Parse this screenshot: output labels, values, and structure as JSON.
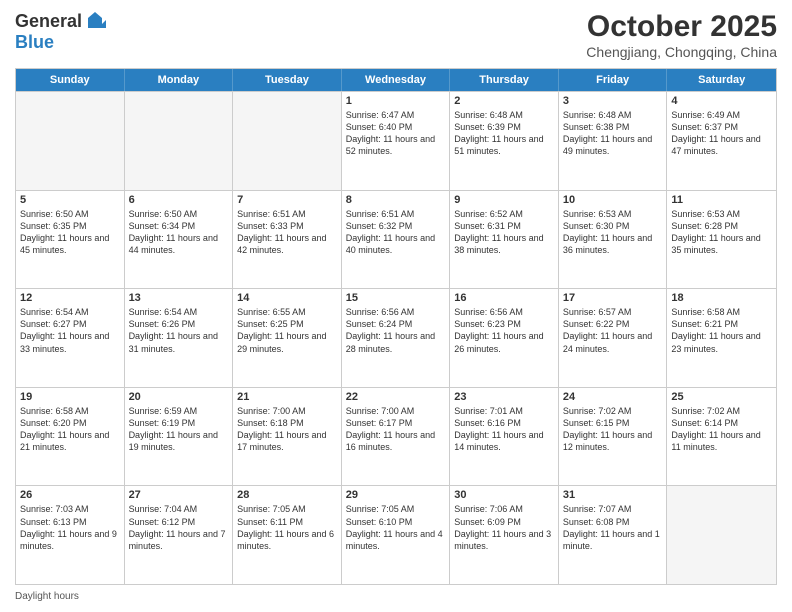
{
  "logo": {
    "general": "General",
    "blue": "Blue"
  },
  "header": {
    "month": "October 2025",
    "location": "Chengjiang, Chongqing, China"
  },
  "weekdays": [
    "Sunday",
    "Monday",
    "Tuesday",
    "Wednesday",
    "Thursday",
    "Friday",
    "Saturday"
  ],
  "weeks": [
    [
      {
        "day": "",
        "detail": ""
      },
      {
        "day": "",
        "detail": ""
      },
      {
        "day": "",
        "detail": ""
      },
      {
        "day": "1",
        "detail": "Sunrise: 6:47 AM\nSunset: 6:40 PM\nDaylight: 11 hours and 52 minutes."
      },
      {
        "day": "2",
        "detail": "Sunrise: 6:48 AM\nSunset: 6:39 PM\nDaylight: 11 hours and 51 minutes."
      },
      {
        "day": "3",
        "detail": "Sunrise: 6:48 AM\nSunset: 6:38 PM\nDaylight: 11 hours and 49 minutes."
      },
      {
        "day": "4",
        "detail": "Sunrise: 6:49 AM\nSunset: 6:37 PM\nDaylight: 11 hours and 47 minutes."
      }
    ],
    [
      {
        "day": "5",
        "detail": "Sunrise: 6:50 AM\nSunset: 6:35 PM\nDaylight: 11 hours and 45 minutes."
      },
      {
        "day": "6",
        "detail": "Sunrise: 6:50 AM\nSunset: 6:34 PM\nDaylight: 11 hours and 44 minutes."
      },
      {
        "day": "7",
        "detail": "Sunrise: 6:51 AM\nSunset: 6:33 PM\nDaylight: 11 hours and 42 minutes."
      },
      {
        "day": "8",
        "detail": "Sunrise: 6:51 AM\nSunset: 6:32 PM\nDaylight: 11 hours and 40 minutes."
      },
      {
        "day": "9",
        "detail": "Sunrise: 6:52 AM\nSunset: 6:31 PM\nDaylight: 11 hours and 38 minutes."
      },
      {
        "day": "10",
        "detail": "Sunrise: 6:53 AM\nSunset: 6:30 PM\nDaylight: 11 hours and 36 minutes."
      },
      {
        "day": "11",
        "detail": "Sunrise: 6:53 AM\nSunset: 6:28 PM\nDaylight: 11 hours and 35 minutes."
      }
    ],
    [
      {
        "day": "12",
        "detail": "Sunrise: 6:54 AM\nSunset: 6:27 PM\nDaylight: 11 hours and 33 minutes."
      },
      {
        "day": "13",
        "detail": "Sunrise: 6:54 AM\nSunset: 6:26 PM\nDaylight: 11 hours and 31 minutes."
      },
      {
        "day": "14",
        "detail": "Sunrise: 6:55 AM\nSunset: 6:25 PM\nDaylight: 11 hours and 29 minutes."
      },
      {
        "day": "15",
        "detail": "Sunrise: 6:56 AM\nSunset: 6:24 PM\nDaylight: 11 hours and 28 minutes."
      },
      {
        "day": "16",
        "detail": "Sunrise: 6:56 AM\nSunset: 6:23 PM\nDaylight: 11 hours and 26 minutes."
      },
      {
        "day": "17",
        "detail": "Sunrise: 6:57 AM\nSunset: 6:22 PM\nDaylight: 11 hours and 24 minutes."
      },
      {
        "day": "18",
        "detail": "Sunrise: 6:58 AM\nSunset: 6:21 PM\nDaylight: 11 hours and 23 minutes."
      }
    ],
    [
      {
        "day": "19",
        "detail": "Sunrise: 6:58 AM\nSunset: 6:20 PM\nDaylight: 11 hours and 21 minutes."
      },
      {
        "day": "20",
        "detail": "Sunrise: 6:59 AM\nSunset: 6:19 PM\nDaylight: 11 hours and 19 minutes."
      },
      {
        "day": "21",
        "detail": "Sunrise: 7:00 AM\nSunset: 6:18 PM\nDaylight: 11 hours and 17 minutes."
      },
      {
        "day": "22",
        "detail": "Sunrise: 7:00 AM\nSunset: 6:17 PM\nDaylight: 11 hours and 16 minutes."
      },
      {
        "day": "23",
        "detail": "Sunrise: 7:01 AM\nSunset: 6:16 PM\nDaylight: 11 hours and 14 minutes."
      },
      {
        "day": "24",
        "detail": "Sunrise: 7:02 AM\nSunset: 6:15 PM\nDaylight: 11 hours and 12 minutes."
      },
      {
        "day": "25",
        "detail": "Sunrise: 7:02 AM\nSunset: 6:14 PM\nDaylight: 11 hours and 11 minutes."
      }
    ],
    [
      {
        "day": "26",
        "detail": "Sunrise: 7:03 AM\nSunset: 6:13 PM\nDaylight: 11 hours and 9 minutes."
      },
      {
        "day": "27",
        "detail": "Sunrise: 7:04 AM\nSunset: 6:12 PM\nDaylight: 11 hours and 7 minutes."
      },
      {
        "day": "28",
        "detail": "Sunrise: 7:05 AM\nSunset: 6:11 PM\nDaylight: 11 hours and 6 minutes."
      },
      {
        "day": "29",
        "detail": "Sunrise: 7:05 AM\nSunset: 6:10 PM\nDaylight: 11 hours and 4 minutes."
      },
      {
        "day": "30",
        "detail": "Sunrise: 7:06 AM\nSunset: 6:09 PM\nDaylight: 11 hours and 3 minutes."
      },
      {
        "day": "31",
        "detail": "Sunrise: 7:07 AM\nSunset: 6:08 PM\nDaylight: 11 hours and 1 minute."
      },
      {
        "day": "",
        "detail": ""
      }
    ]
  ],
  "footer": {
    "daylight_hours": "Daylight hours"
  }
}
